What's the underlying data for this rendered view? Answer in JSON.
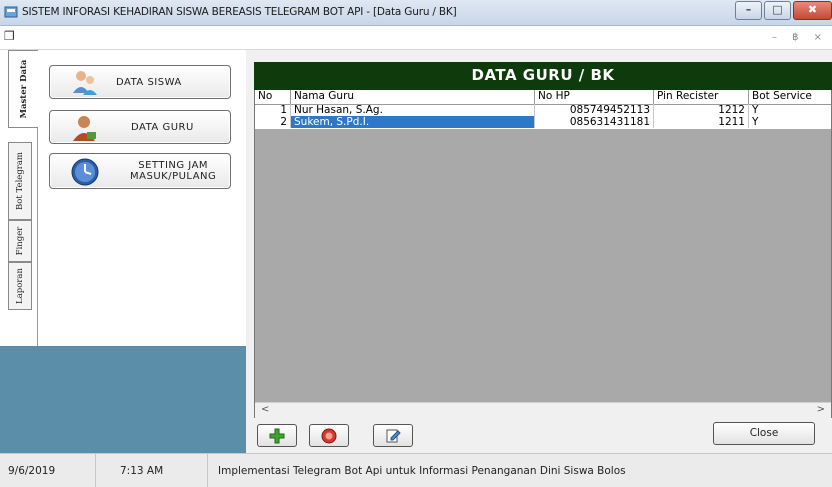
{
  "window": {
    "title": "SISTEM INFORASI KEHADIRAN SISWA BEREASIS TELEGRAM BOT API - [Data Guru / BK]",
    "minimize_glyph": "–",
    "maximize_glyph": "□",
    "close_glyph": "✖"
  },
  "mdi": {
    "buttons": "– ฿ ×"
  },
  "vertical_tabs": [
    "Master Data",
    "Bot Telegram",
    "Finger",
    "Laporan"
  ],
  "nav": {
    "items": [
      {
        "label": "DATA SISWA"
      },
      {
        "label": "DATA GURU"
      },
      {
        "label_line1": "SETTING JAM",
        "label_line2": "MASUK/PULANG"
      }
    ]
  },
  "main": {
    "header_title": "DATA GURU / BK",
    "columns": [
      "No",
      "Nama Guru",
      "No HP",
      "Pin Recister",
      "Bot Service"
    ],
    "rows": [
      {
        "no": "1",
        "nama": "Nur Hasan, S.Ag.",
        "hp": "085749452113",
        "pin": "1212",
        "bot": "Y"
      },
      {
        "no": "2",
        "nama": "Sukem, S.Pd.I.",
        "hp": "085631431181",
        "pin": "1211",
        "bot": "Y"
      }
    ],
    "selected_row": 1,
    "scroll_left": "<",
    "scroll_right": ">",
    "close_label": "Close"
  },
  "status": {
    "date": "9/6/2019",
    "time": "7:13 AM",
    "message": "Implementasi Telegram Bot Api untuk Informasi Penanganan Dini Siswa  Bolos"
  },
  "colors": {
    "header_bg": "#0e3b0b",
    "selected_row": "#2f78c8",
    "blue_panel": "#5b8fa9",
    "grid_bg": "#a9a9a9"
  }
}
